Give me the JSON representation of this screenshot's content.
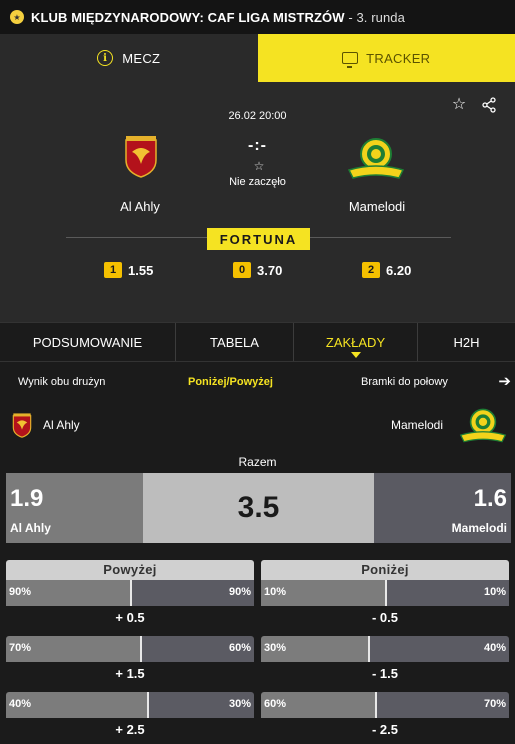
{
  "header": {
    "title": "KLUB MIĘDZYNARODOWY: CAF LIGA MISTRZÓW",
    "round": " - 3. runda"
  },
  "top_tabs": {
    "match": "MECZ",
    "tracker": "TRACKER"
  },
  "match": {
    "datetime": "26.02 20:00",
    "score": "-:-",
    "status": "Nie zaczęło",
    "home": "Al Ahly",
    "away": "Mamelodi",
    "bookmaker": "FORTUNA",
    "odds": [
      {
        "label": "1",
        "value": "1.55"
      },
      {
        "label": "0",
        "value": "3.70"
      },
      {
        "label": "2",
        "value": "6.20"
      }
    ]
  },
  "sub_tabs": [
    "PODSUMOWANIE",
    "TABELA",
    "ZAKŁADY",
    "H2H"
  ],
  "bet_tabs": [
    "Wynik obu drużyn",
    "Poniżej/Powyżej",
    "Bramki do połowy"
  ],
  "total": {
    "label": "Razem",
    "home_odd": "1.9",
    "line": "3.5",
    "away_odd": "1.6",
    "home": "Al Ahly",
    "away": "Mamelodi"
  },
  "over": {
    "title": "Powyżej",
    "rows": [
      {
        "left": "90%",
        "right": "90%",
        "fill": 0.5,
        "line": "+ 0.5"
      },
      {
        "left": "70%",
        "right": "60%",
        "fill": 0.54,
        "line": "+ 1.5"
      },
      {
        "left": "40%",
        "right": "30%",
        "fill": 0.57,
        "line": "+ 2.5"
      }
    ]
  },
  "under": {
    "title": "Poniżej",
    "rows": [
      {
        "left": "10%",
        "right": "10%",
        "fill": 0.5,
        "line": "- 0.5"
      },
      {
        "left": "30%",
        "right": "40%",
        "fill": 0.43,
        "line": "- 1.5"
      },
      {
        "left": "60%",
        "right": "70%",
        "fill": 0.46,
        "line": "- 2.5"
      }
    ]
  },
  "colors": {
    "accent": "#f5e322",
    "badge": "#f5c000",
    "home_bar": "#7c7c7c",
    "away_bar": "#5b5b63"
  }
}
